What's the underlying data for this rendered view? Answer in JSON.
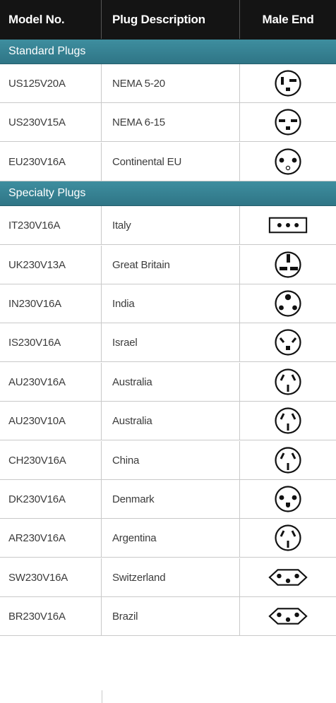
{
  "header": {
    "model_label": "Model No.",
    "description_label": "Plug Description",
    "male_end_label": "Male End"
  },
  "sections": [
    {
      "title": "Standard Plugs",
      "rows": [
        {
          "model": "US125V20A",
          "description": "NEMA 5-20",
          "icon": "nema-5-20-plug-icon"
        },
        {
          "model": "US230V15A",
          "description": "NEMA 6-15",
          "icon": "nema-6-15-plug-icon"
        },
        {
          "model": "EU230V16A",
          "description": "Continental EU",
          "icon": "continental-eu-plug-icon"
        }
      ]
    },
    {
      "title": "Specialty Plugs",
      "rows": [
        {
          "model": "IT230V16A",
          "description": "Italy",
          "icon": "italy-plug-icon"
        },
        {
          "model": "UK230V13A",
          "description": "Great Britain",
          "icon": "great-britain-plug-icon"
        },
        {
          "model": "IN230V16A",
          "description": "India",
          "icon": "india-plug-icon"
        },
        {
          "model": "IS230V16A",
          "description": "Israel",
          "icon": "israel-plug-icon"
        },
        {
          "model": "AU230V16A",
          "description": "Australia",
          "icon": "australia-plug-icon"
        },
        {
          "model": "AU230V10A",
          "description": "Australia",
          "icon": "australia-plug-icon"
        },
        {
          "model": "CH230V16A",
          "description": "China",
          "icon": "china-plug-icon"
        },
        {
          "model": "DK230V16A",
          "description": "Denmark",
          "icon": "denmark-plug-icon"
        },
        {
          "model": "AR230V16A",
          "description": "Argentina",
          "icon": "argentina-plug-icon"
        },
        {
          "model": "SW230V16A",
          "description": "Switzerland",
          "icon": "switzerland-plug-icon"
        },
        {
          "model": "BR230V16A",
          "description": "Brazil",
          "icon": "brazil-plug-icon"
        }
      ]
    }
  ]
}
